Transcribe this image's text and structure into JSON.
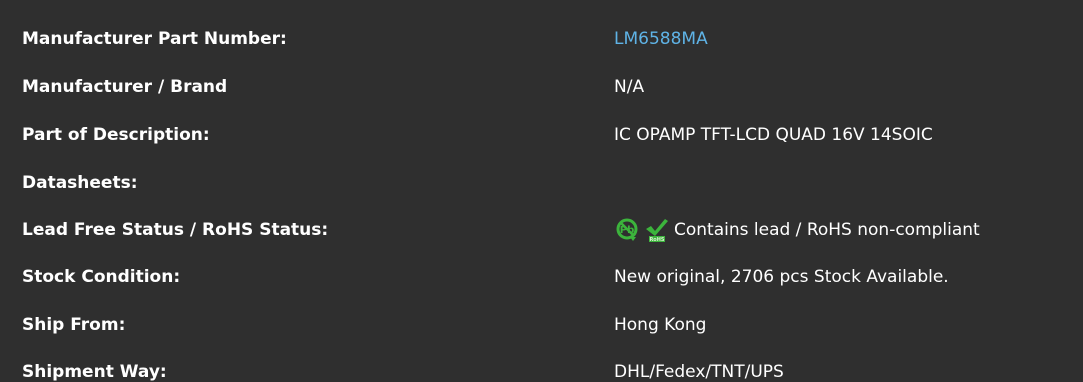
{
  "rows": [
    {
      "label": "Manufacturer Part Number:",
      "value": "LM6588MA"
    },
    {
      "label": "Manufacturer / Brand",
      "value": "N/A"
    },
    {
      "label": "Part of Description:",
      "value": "IC OPAMP TFT-LCD QUAD 16V 14SOIC"
    },
    {
      "label": "Datasheets:",
      "value": ""
    },
    {
      "label": "Lead Free Status / RoHS Status:",
      "value": "Contains lead / RoHS non-compliant"
    },
    {
      "label": "Stock Condition:",
      "value": "New original, 2706 pcs Stock Available."
    },
    {
      "label": "Ship From:",
      "value": "Hong Kong"
    },
    {
      "label": "Shipment Way:",
      "value": "DHL/Fedex/TNT/UPS"
    }
  ],
  "icons": {
    "lead_free": "lead-free-icon",
    "rohs": "rohs-check-icon",
    "rohs_text": "RoHS"
  },
  "colors": {
    "background": "#2f2f2f",
    "text": "#ffffff",
    "link": "#5fb3e6",
    "icon_green": "#3cb43c"
  }
}
